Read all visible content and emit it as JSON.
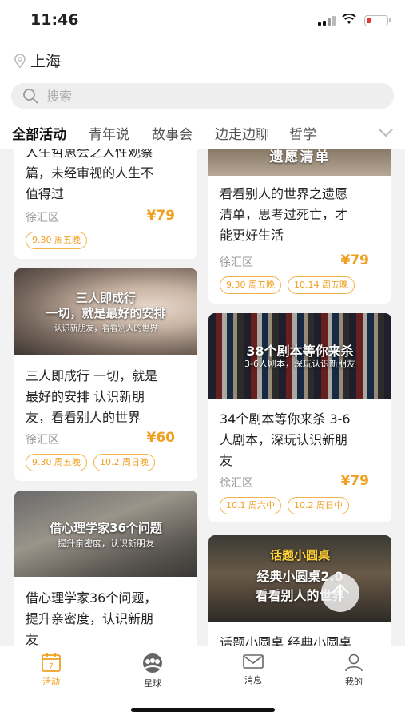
{
  "status_bar": {
    "time": "11:46"
  },
  "location": {
    "city": "上海"
  },
  "search": {
    "placeholder": "搜索"
  },
  "tabs": [
    {
      "label": "全部活动",
      "active": true
    },
    {
      "label": "青年说",
      "active": false
    },
    {
      "label": "故事会",
      "active": false
    },
    {
      "label": "边走边聊",
      "active": false
    },
    {
      "label": "哲学",
      "active": false
    }
  ],
  "cards": [
    {
      "title_lines": [
        "人生哲思会之人性观察",
        "篇，未经审视的人生不",
        "值得过"
      ],
      "district": "徐汇区",
      "price": "¥79",
      "tags": [
        "9.30 周五晚"
      ]
    },
    {
      "image_text": "遗愿清单",
      "title_lines": [
        "看看别人的世界之遗愿",
        "清单，思考过死亡，才",
        "能更好生活"
      ],
      "district": "徐汇区",
      "price": "¥79",
      "tags": [
        "9.30 周五晚",
        "10.14 周五晚"
      ]
    },
    {
      "image_text": [
        "三人即成行",
        "一切，就是最好的安排",
        "认识新朋友，看看别人的世界"
      ],
      "title_lines": [
        "三人即成行 一切，就是",
        "最好的安排 认识新朋",
        "友，看看别人的世界"
      ],
      "district": "徐汇区",
      "price": "¥60",
      "tags": [
        "9.30 周五晚",
        "10.2 周日晚"
      ]
    },
    {
      "image_text": [
        "38个剧本等你来杀",
        "3-6人剧本，深玩认识新朋友"
      ],
      "title_lines": [
        "34个剧本等你来杀 3-6",
        "人剧本，深玩认识新朋",
        "友"
      ],
      "district": "徐汇区",
      "price": "¥79",
      "tags": [
        "10.1 周六中",
        "10.2 周日中"
      ]
    },
    {
      "image_text": [
        "借心理学家36个问题",
        "提升亲密度，认识新朋友"
      ],
      "title_lines": [
        "借心理学家36个问题，",
        "提升亲密度，认识新朋",
        "友"
      ]
    },
    {
      "image_text": [
        "话题小圆桌",
        "经典小圆桌2.0",
        "看看别人的世界"
      ],
      "title_lines": [
        "话题小圆桌 经典小圆桌"
      ]
    }
  ],
  "bottom_nav": [
    {
      "label": "活动",
      "icon": "calendar-icon",
      "active": true
    },
    {
      "label": "星球",
      "icon": "planet-icon",
      "active": false
    },
    {
      "label": "消息",
      "icon": "mail-icon",
      "active": false
    },
    {
      "label": "我的",
      "icon": "person-icon",
      "active": false
    }
  ],
  "colors": {
    "accent": "#f0a020",
    "tag_border": "#f0b44a"
  }
}
